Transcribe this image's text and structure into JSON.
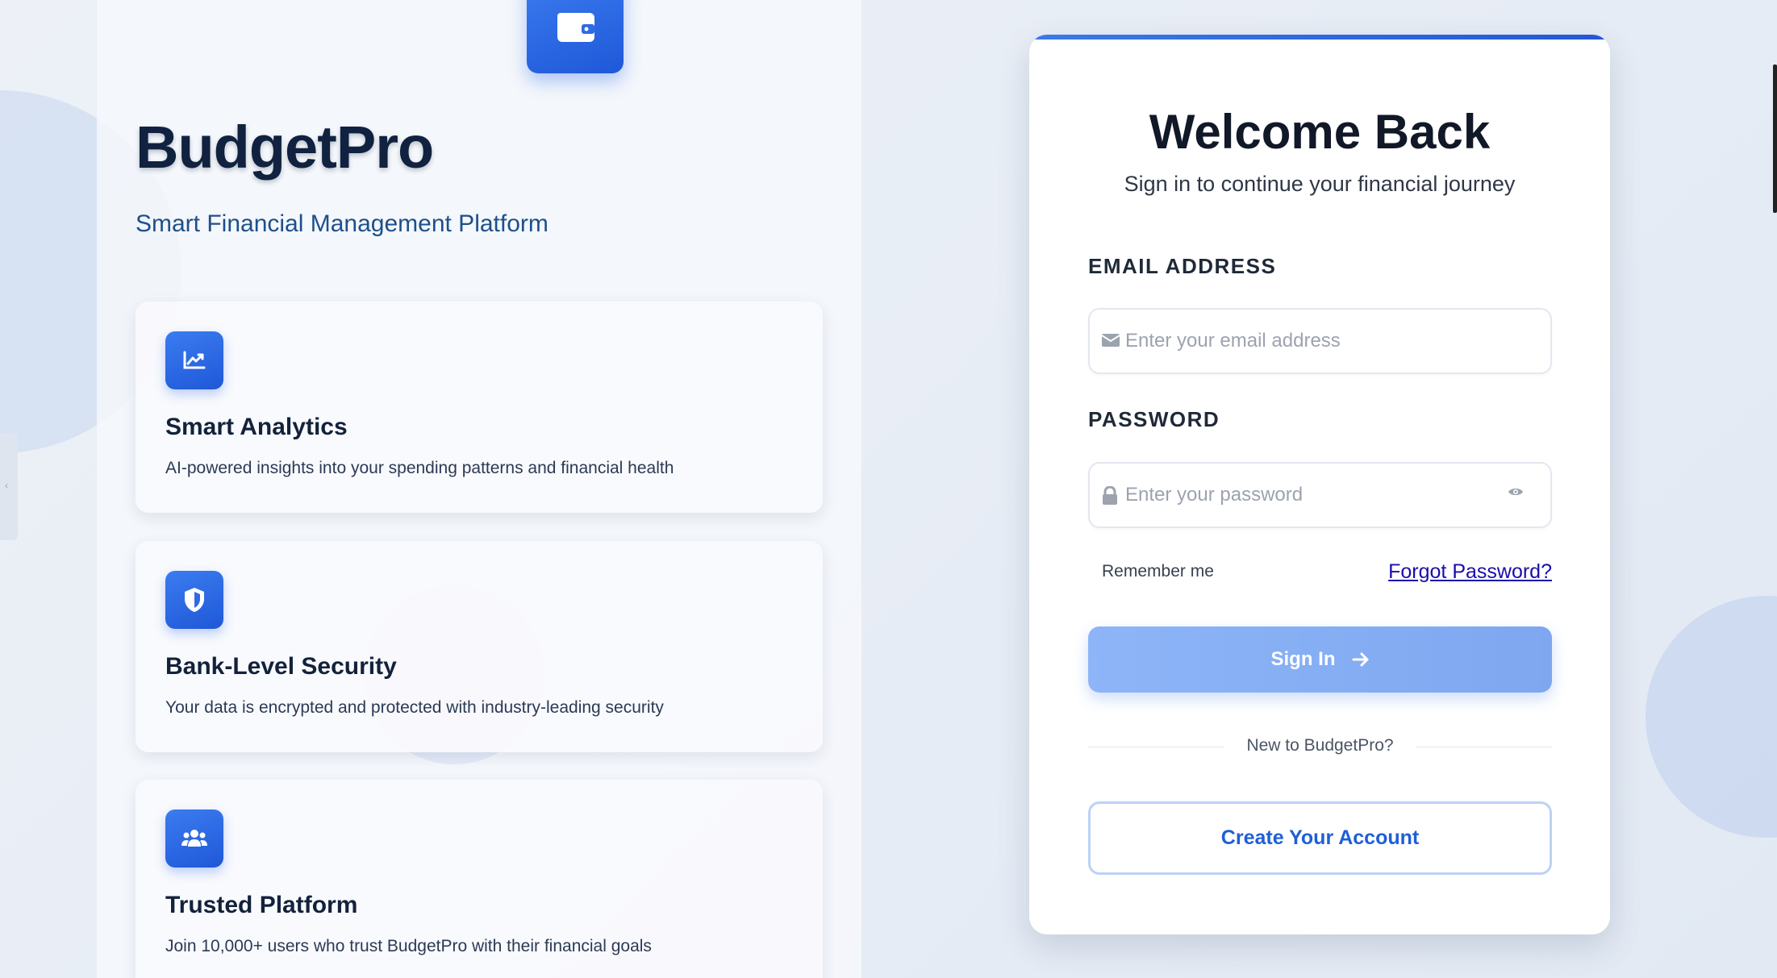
{
  "brand": {
    "name": "BudgetPro",
    "tagline": "Smart Financial Management Platform"
  },
  "features": [
    {
      "icon": "chart-line-icon",
      "title": "Smart Analytics",
      "description": "AI-powered insights into your spending patterns and financial health"
    },
    {
      "icon": "shield-icon",
      "title": "Bank-Level Security",
      "description": "Your data is encrypted and protected with industry-leading security"
    },
    {
      "icon": "users-icon",
      "title": "Trusted Platform",
      "description": "Join 10,000+ users who trust BudgetPro with their financial goals"
    }
  ],
  "login": {
    "title": "Welcome Back",
    "subtitle": "Sign in to continue your financial journey",
    "email_label": "EMAIL ADDRESS",
    "email_placeholder": "Enter your email address",
    "password_label": "PASSWORD",
    "password_placeholder": "Enter your password",
    "remember_label": "Remember me",
    "forgot_label": "Forgot Password?",
    "signin_label": "Sign In",
    "divider_text": "New to BudgetPro?",
    "create_label": "Create Your Account"
  },
  "colors": {
    "accent": "#2563eb",
    "signin_button": "#8db5f7",
    "title_text": "#111827",
    "link": "#1a0dab"
  }
}
